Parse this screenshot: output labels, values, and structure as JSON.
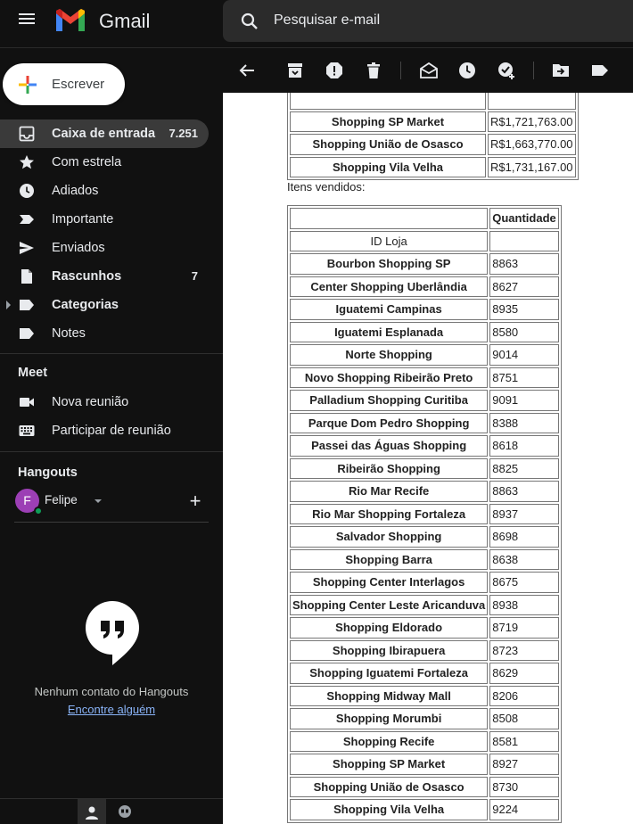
{
  "app": {
    "brand": "Gmail"
  },
  "search": {
    "placeholder": "Pesquisar e-mail"
  },
  "compose": {
    "label": "Escrever"
  },
  "sidebar": {
    "items": [
      {
        "label": "Caixa de entrada",
        "count": "7.251",
        "icon": "inbox-icon"
      },
      {
        "label": "Com estrela",
        "count": "",
        "icon": "star-icon"
      },
      {
        "label": "Adiados",
        "count": "",
        "icon": "clock-icon"
      },
      {
        "label": "Importante",
        "count": "",
        "icon": "important-icon"
      },
      {
        "label": "Enviados",
        "count": "",
        "icon": "send-icon"
      },
      {
        "label": "Rascunhos",
        "count": "7",
        "icon": "draft-icon"
      },
      {
        "label": "Categorias",
        "count": "",
        "icon": "label-icon"
      },
      {
        "label": "Notes",
        "count": "",
        "icon": "label-icon"
      }
    ]
  },
  "meet": {
    "title": "Meet",
    "new_meeting": "Nova reunião",
    "join_meeting": "Participar de reunião"
  },
  "hangouts": {
    "title": "Hangouts",
    "user_initial": "F",
    "user_name": "Felipe",
    "empty_text": "Nenhum contato do Hangouts",
    "find_link": "Encontre alguém"
  },
  "email": {
    "top_rows": [
      {
        "name": "Shopping SP Market",
        "value": "R$1,721,763.00"
      },
      {
        "name": "Shopping União de Osasco",
        "value": "R$1,663,770.00"
      },
      {
        "name": "Shopping Vila Velha",
        "value": "R$1,731,167.00"
      }
    ],
    "items_label": "Itens vendidos:",
    "qty_header": "Quantidade",
    "id_header": "ID Loja",
    "rows": [
      {
        "name": "Bourbon Shopping SP",
        "qty": "8863"
      },
      {
        "name": "Center Shopping Uberlândia",
        "qty": "8627"
      },
      {
        "name": "Iguatemi Campinas",
        "qty": "8935"
      },
      {
        "name": "Iguatemi Esplanada",
        "qty": "8580"
      },
      {
        "name": "Norte Shopping",
        "qty": "9014"
      },
      {
        "name": "Novo Shopping Ribeirão Preto",
        "qty": "8751"
      },
      {
        "name": "Palladium Shopping Curitiba",
        "qty": "9091"
      },
      {
        "name": "Parque Dom Pedro Shopping",
        "qty": "8388"
      },
      {
        "name": "Passei das Águas Shopping",
        "qty": "8618"
      },
      {
        "name": "Ribeirão Shopping",
        "qty": "8825"
      },
      {
        "name": "Rio Mar Recife",
        "qty": "8863"
      },
      {
        "name": "Rio Mar Shopping Fortaleza",
        "qty": "8937"
      },
      {
        "name": "Salvador Shopping",
        "qty": "8698"
      },
      {
        "name": "Shopping Barra",
        "qty": "8638"
      },
      {
        "name": "Shopping Center Interlagos",
        "qty": "8675"
      },
      {
        "name": "Shopping Center Leste Aricanduva",
        "qty": "8938"
      },
      {
        "name": "Shopping Eldorado",
        "qty": "8719"
      },
      {
        "name": "Shopping Ibirapuera",
        "qty": "8723"
      },
      {
        "name": "Shopping Iguatemi Fortaleza",
        "qty": "8629"
      },
      {
        "name": "Shopping Midway Mall",
        "qty": "8206"
      },
      {
        "name": "Shopping Morumbi",
        "qty": "8508"
      },
      {
        "name": "Shopping Recife",
        "qty": "8581"
      },
      {
        "name": "Shopping SP Market",
        "qty": "8927"
      },
      {
        "name": "Shopping União de Osasco",
        "qty": "8730"
      },
      {
        "name": "Shopping Vila Velha",
        "qty": "9224"
      }
    ]
  }
}
